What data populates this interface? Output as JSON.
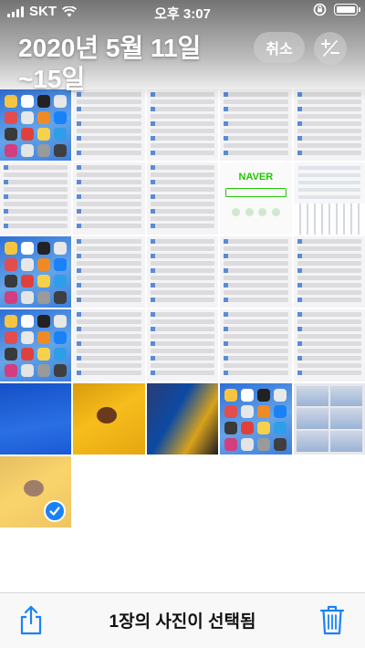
{
  "status_bar": {
    "carrier": "SKT",
    "time": "오후 3:07"
  },
  "header": {
    "title_line1": "2020년 5월 11일",
    "title_line2": "~15일",
    "cancel_label": "취소",
    "plus_minus_icon": "plus-minus-icon"
  },
  "grid": {
    "cells": [
      {
        "kind": "home-screen"
      },
      {
        "kind": "settings-list"
      },
      {
        "kind": "settings-list"
      },
      {
        "kind": "settings-list"
      },
      {
        "kind": "settings-list"
      },
      {
        "kind": "dialog-screenshot"
      },
      {
        "kind": "settings-list"
      },
      {
        "kind": "settings-list"
      },
      {
        "kind": "naver-page",
        "logo": "NAVER"
      },
      {
        "kind": "keyboard-screenshot"
      },
      {
        "kind": "home-screen"
      },
      {
        "kind": "settings-list"
      },
      {
        "kind": "settings-list"
      },
      {
        "kind": "settings-list"
      },
      {
        "kind": "settings-list"
      },
      {
        "kind": "home-screen"
      },
      {
        "kind": "settings-list"
      },
      {
        "kind": "settings-list"
      },
      {
        "kind": "settings-list"
      },
      {
        "kind": "settings-list"
      },
      {
        "kind": "blue-photo"
      },
      {
        "kind": "yellow-photo"
      },
      {
        "kind": "blurry-photo"
      },
      {
        "kind": "home-screen"
      },
      {
        "kind": "collage"
      },
      {
        "kind": "yellow-photo",
        "selected": true
      }
    ]
  },
  "toolbar": {
    "selected_label": "1장의 사진이 선택됨",
    "share_icon": "share-icon",
    "trash_icon": "trash-icon"
  },
  "colors": {
    "accent": "#1a82f7"
  }
}
